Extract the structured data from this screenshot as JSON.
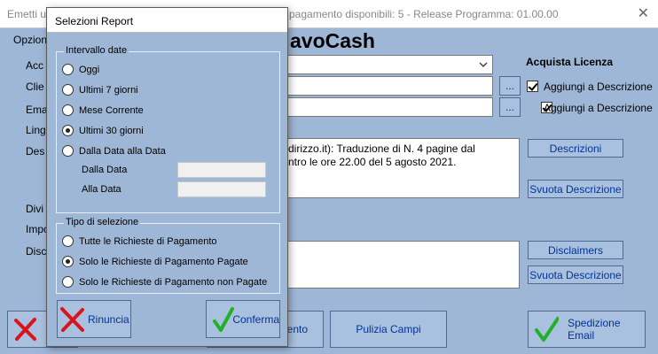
{
  "main": {
    "title_left": "Emetti u",
    "title_right": "pagamento disponibili: 5 - Release Programma: 01.00.00",
    "close_glyph": "✕",
    "menu_options": "Opzion",
    "app_name": "avoCash",
    "labels": {
      "acc": "Acc",
      "clie": "Clie",
      "ema": "Ema",
      "ling": "Ling",
      "des": "Des",
      "divi": "Divi",
      "impo": "Impo",
      "disc": "Disc"
    },
    "license_title": "Acquista Licenza",
    "browse_label": "...",
    "aggiungi_1": "Aggiungi a Descrizione",
    "aggiungi_2": "Aggiungi a Descrizione",
    "description_text": "dirizzo.it): Traduzione di N. 4 pagine dal\nntro le ore 22.00 del 5 agosto 2021.",
    "btn_descrizioni": "Descrizioni",
    "btn_svuota_descrizione": "Svuota Descrizione",
    "btn_disclaimers": "Disclaimers",
    "btn_svuota_descrizione_2": "Svuota Descrizione",
    "btn_pagamento_fragment": "ento",
    "btn_pulizia": "Pulizia Campi",
    "btn_spedizione": "Spedizione Email"
  },
  "dialog": {
    "title": "Selezioni Report",
    "date_group_legend": "Intervallo date",
    "date_options": [
      {
        "label": "Oggi",
        "selected": false
      },
      {
        "label": "Ultimi 7 giorni",
        "selected": false
      },
      {
        "label": "Mese Corrente",
        "selected": false
      },
      {
        "label": "Ultimi 30 giorni",
        "selected": true
      },
      {
        "label": "Dalla Data alla Data",
        "selected": false
      }
    ],
    "dalla_data_label": "Dalla Data",
    "alla_data_label": "Alla Data",
    "type_group_legend": "Tipo di selezione",
    "type_options": [
      {
        "label": "Tutte le Richieste di Pagamento",
        "selected": false
      },
      {
        "label": "Solo le Richieste di Pagamento Pagate",
        "selected": true
      },
      {
        "label": "Solo le Richieste di Pagamento non Pagate",
        "selected": false
      }
    ],
    "btn_rinuncia": "Rinuncia",
    "btn_conferma": "Conferma"
  },
  "colors": {
    "background": "#9fb7d6",
    "button_text": "#003399",
    "cancel_red": "#d8141c",
    "confirm_green": "#22b02a"
  }
}
